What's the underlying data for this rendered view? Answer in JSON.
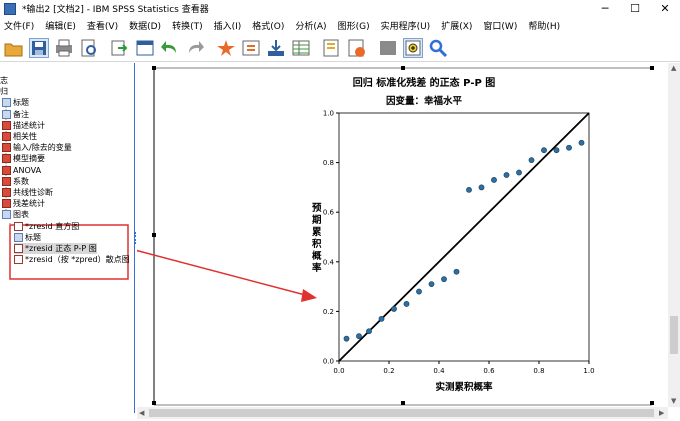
{
  "window": {
    "title": "*输出2 [文档2] - IBM SPSS Statistics 查看器",
    "minimize": "─",
    "maximize": "☐",
    "close": "✕"
  },
  "menu": [
    "文件(F)",
    "编辑(E)",
    "查看(V)",
    "数据(D)",
    "转换(T)",
    "插入(I)",
    "格式(O)",
    "分析(A)",
    "图形(G)",
    "实用程序(U)",
    "扩展(X)",
    "窗口(W)",
    "帮助(H)"
  ],
  "toolbar": [
    "open-icon",
    "save-icon",
    "print-icon",
    "print-preview-icon",
    "export-icon",
    "recall-dialog-icon",
    "undo-icon",
    "redo-icon",
    "goto-data-icon",
    "goto-case-icon",
    "goto-variable-icon",
    "variables-icon",
    "create-title-icon",
    "create-chart-icon",
    "hide-icon",
    "insert-output-icon",
    "find-icon"
  ],
  "tree": {
    "items": [
      {
        "label": "志",
        "icon": "none",
        "indent": 0
      },
      {
        "label": "归",
        "icon": "none",
        "indent": 0
      },
      {
        "label": "标题",
        "icon": "book",
        "indent": 1
      },
      {
        "label": "备注",
        "icon": "book",
        "indent": 1
      },
      {
        "label": "描述统计",
        "icon": "red",
        "indent": 1
      },
      {
        "label": "相关性",
        "icon": "red",
        "indent": 1
      },
      {
        "label": "输入/除去的变量",
        "icon": "red",
        "indent": 1
      },
      {
        "label": "模型摘要",
        "icon": "red",
        "indent": 1
      },
      {
        "label": "ANOVA",
        "icon": "red",
        "indent": 1
      },
      {
        "label": "系数",
        "icon": "red",
        "indent": 1
      },
      {
        "label": "共线性诊断",
        "icon": "red",
        "indent": 1
      },
      {
        "label": "残差统计",
        "icon": "red",
        "indent": 1
      },
      {
        "label": "图表",
        "icon": "book",
        "indent": 1
      },
      {
        "label": "*zresid 直方图",
        "icon": "chart",
        "indent": 2
      },
      {
        "label": "标题",
        "icon": "book",
        "indent": 2
      },
      {
        "label": "*zresid 正态 P-P 图",
        "icon": "chart",
        "indent": 2,
        "selected": true
      },
      {
        "label": "*zresid（按 *zpred）散点图",
        "icon": "chart",
        "indent": 2
      }
    ]
  },
  "chart_data": {
    "type": "scatter",
    "title": "回归 标准化残差 的正态 P-P 图",
    "subtitle": "因变量：幸福水平",
    "xlabel": "实测累积概率",
    "ylabel": "预期累积概率",
    "xlim": [
      0.0,
      1.0
    ],
    "ylim": [
      0.0,
      1.0
    ],
    "xticks": [
      "0.0",
      "0.2",
      "0.4",
      "0.6",
      "0.8",
      "1.0"
    ],
    "yticks": [
      "0.0",
      "0.2",
      "0.4",
      "0.6",
      "0.8",
      "1.0"
    ],
    "reference_line": [
      [
        0,
        0
      ],
      [
        1,
        1
      ]
    ],
    "points": [
      [
        0.03,
        0.09
      ],
      [
        0.08,
        0.1
      ],
      [
        0.12,
        0.12
      ],
      [
        0.17,
        0.17
      ],
      [
        0.22,
        0.21
      ],
      [
        0.27,
        0.23
      ],
      [
        0.32,
        0.28
      ],
      [
        0.37,
        0.31
      ],
      [
        0.42,
        0.33
      ],
      [
        0.47,
        0.36
      ],
      [
        0.52,
        0.69
      ],
      [
        0.57,
        0.7
      ],
      [
        0.62,
        0.73
      ],
      [
        0.67,
        0.75
      ],
      [
        0.72,
        0.76
      ],
      [
        0.77,
        0.81
      ],
      [
        0.82,
        0.85
      ],
      [
        0.87,
        0.85
      ],
      [
        0.92,
        0.86
      ],
      [
        0.97,
        0.88
      ]
    ],
    "point_color": "#2f6fa0",
    "grid": false
  }
}
